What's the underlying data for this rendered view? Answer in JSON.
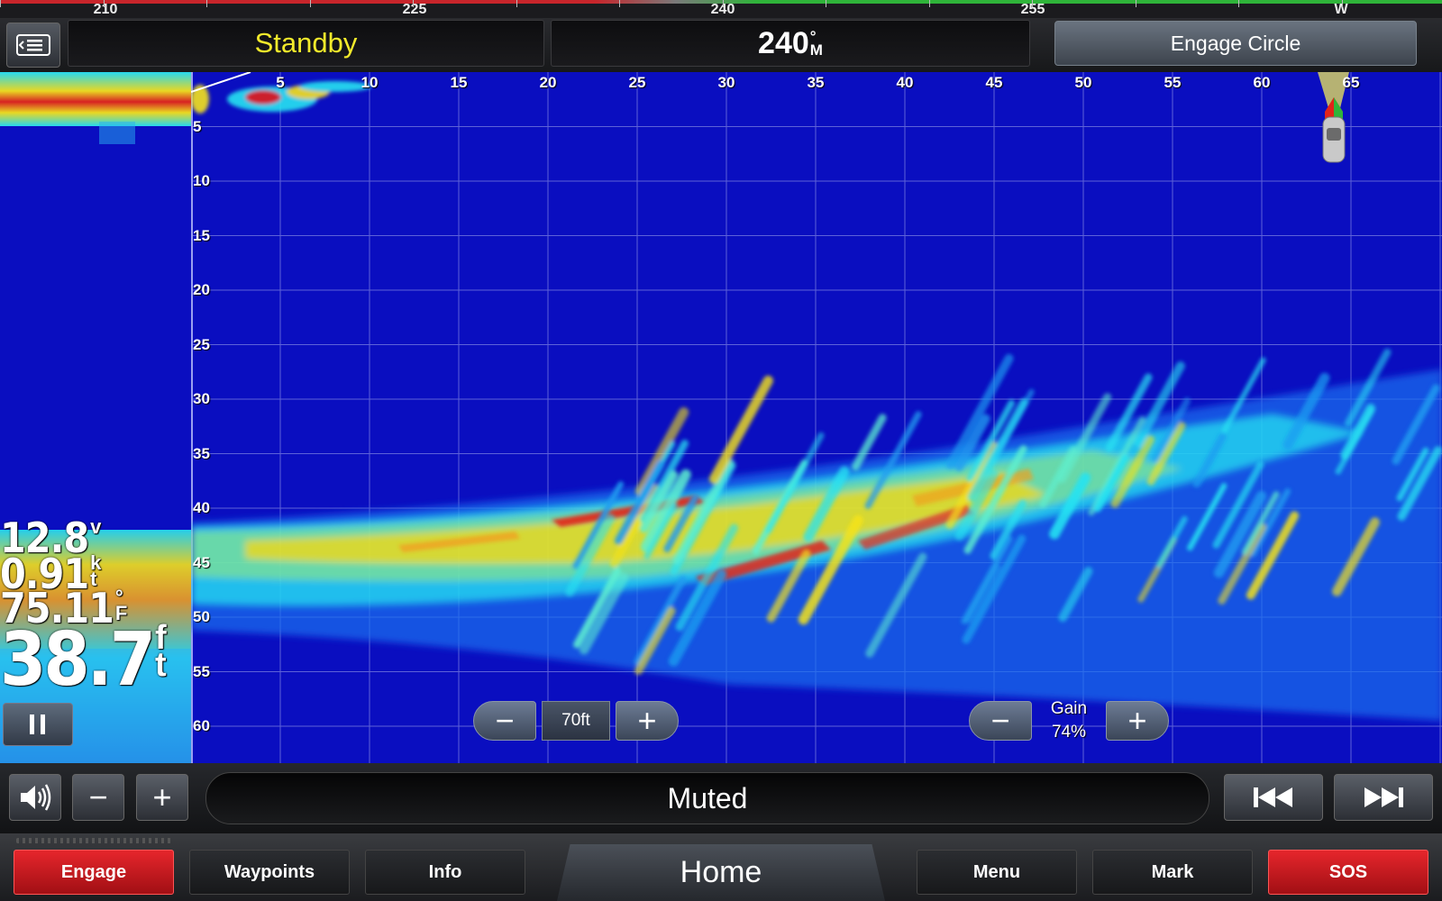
{
  "compass": {
    "labels": [
      {
        "text": "210",
        "pos": 117
      },
      {
        "text": "225",
        "pos": 460
      },
      {
        "text": "240",
        "pos": 802
      },
      {
        "text": "255",
        "pos": 1146
      },
      {
        "text": "W",
        "pos": 1488
      }
    ]
  },
  "topbar": {
    "menu_icon": "list-menu-icon",
    "status": "Standby",
    "heading_value": "240",
    "heading_unit_top": "°",
    "heading_unit_bottom": "M",
    "engage_circle_label": "Engage Circle"
  },
  "sonar": {
    "range_labels": [
      "5",
      "10",
      "15",
      "20",
      "25",
      "30",
      "35",
      "40",
      "45",
      "50",
      "55",
      "60",
      "65"
    ],
    "depth_labels": [
      "5",
      "10",
      "15",
      "20",
      "25",
      "30",
      "35",
      "40",
      "45",
      "50",
      "55",
      "60"
    ],
    "colors": {
      "water": "#0a0ec0",
      "strong": "#e2231a",
      "medium": "#f5e31a",
      "weak": "#27e3f2"
    }
  },
  "readings": {
    "voltage": {
      "value": "12.8",
      "unit": [
        "v"
      ]
    },
    "speed": {
      "value": "0.91",
      "unit": [
        "k",
        "t"
      ]
    },
    "temp": {
      "value": "75.11",
      "unit": [
        "°",
        "F"
      ]
    },
    "depth": {
      "value": "38.7",
      "unit": [
        "f",
        "t"
      ]
    }
  },
  "controls": {
    "pause_icon": "pause-icon",
    "range": {
      "minus": "−",
      "value": "70ft",
      "plus": "+"
    },
    "gain": {
      "minus": "−",
      "label": "Gain",
      "value": "74%",
      "plus": "+"
    }
  },
  "audio": {
    "speaker_icon": "speaker-icon",
    "vol_down": "−",
    "vol_up": "+",
    "status": "Muted",
    "prev_icon": "skip-back-icon",
    "next_icon": "skip-forward-icon"
  },
  "nav": {
    "engage": "Engage",
    "waypoints": "Waypoints",
    "info": "Info",
    "home": "Home",
    "menu": "Menu",
    "mark": "Mark",
    "sos": "SOS"
  }
}
